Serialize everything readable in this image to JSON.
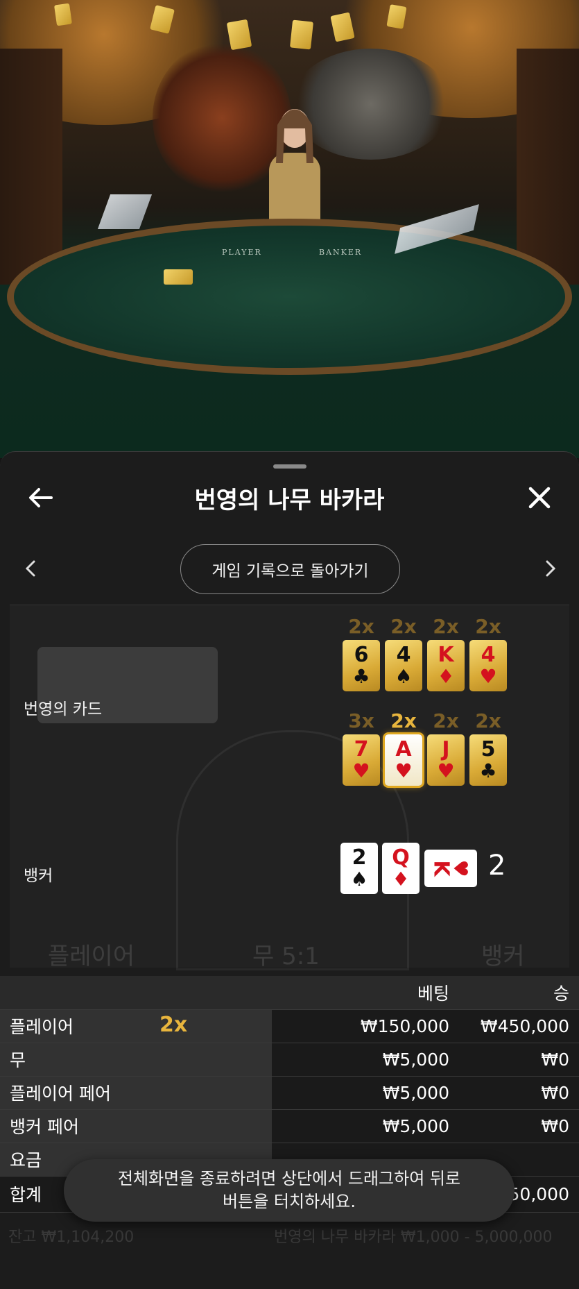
{
  "video": {
    "table_label_player": "PLAYER",
    "table_label_banker": "BANKER"
  },
  "panel": {
    "title": "번영의 나무 바카라",
    "back_icon": "arrow-left-icon",
    "close_icon": "close-icon",
    "back_to_history": "게임 기록으로 돌아가기",
    "prev_icon": "chevron-left-icon",
    "next_icon": "chevron-right-icon"
  },
  "result": {
    "prosperity_label": "번영의 카드",
    "banker_label": "뱅커",
    "banker_score": "2",
    "prosperity_row1": [
      {
        "mult": "2x",
        "rank": "6",
        "suit": "♣",
        "color": "black",
        "highlight": false
      },
      {
        "mult": "2x",
        "rank": "4",
        "suit": "♠",
        "color": "black",
        "highlight": false
      },
      {
        "mult": "2x",
        "rank": "K",
        "suit": "♦",
        "color": "red",
        "highlight": false
      },
      {
        "mult": "2x",
        "rank": "4",
        "suit": "♥",
        "color": "red",
        "highlight": false
      }
    ],
    "prosperity_row2": [
      {
        "mult": "3x",
        "rank": "7",
        "suit": "♥",
        "color": "red",
        "highlight": false
      },
      {
        "mult": "2x",
        "rank": "A",
        "suit": "♥",
        "color": "red",
        "highlight": true
      },
      {
        "mult": "2x",
        "rank": "J",
        "suit": "♥",
        "color": "red",
        "highlight": false
      },
      {
        "mult": "2x",
        "rank": "5",
        "suit": "♣",
        "color": "black",
        "highlight": false
      }
    ],
    "banker_cards": [
      {
        "rank": "2",
        "suit": "♠",
        "color": "black"
      },
      {
        "rank": "Q",
        "suit": "♦",
        "color": "red"
      },
      {
        "rank": "K",
        "suit": "♥",
        "color": "red"
      }
    ],
    "background_labels": {
      "player": "플레이어",
      "tie": "무 5:1",
      "banker": "뱅커"
    }
  },
  "bets_table": {
    "headers": {
      "bet": "베팅",
      "win": "승"
    },
    "rows": [
      {
        "name": "플레이어",
        "multiplier": "2x",
        "bet": "₩150,000",
        "win": "₩450,000"
      },
      {
        "name": "무",
        "multiplier": "",
        "bet": "₩5,000",
        "win": "₩0"
      },
      {
        "name": "플레이어 페어",
        "multiplier": "",
        "bet": "₩5,000",
        "win": "₩0"
      },
      {
        "name": "뱅커 페어",
        "multiplier": "",
        "bet": "₩5,000",
        "win": "₩0"
      },
      {
        "name": "요금",
        "multiplier": "",
        "bet": "",
        "win": ""
      }
    ],
    "total_label": "합계",
    "total_value": "50,000"
  },
  "toast": {
    "line1": "전체화면을 종료하려면 상단에서 드래그하여 뒤로",
    "line2": "버튼을 터치하세요."
  },
  "footer_faint": {
    "balance": "잔고 ₩1,104,200",
    "limits": "번영의 나무 바카라 ₩1,000 - 5,000,000"
  },
  "colors": {
    "gold": "#e8b53d",
    "panel_bg": "#1c1c1c",
    "red_suit": "#d4121e"
  }
}
